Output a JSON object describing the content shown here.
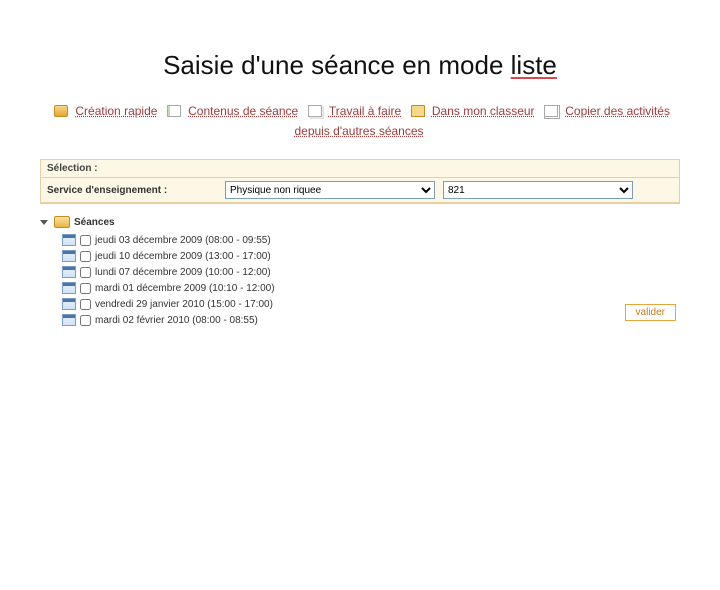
{
  "page": {
    "title_before": "Saisie d'une séance en mode ",
    "title_underlined": "liste"
  },
  "toolbar": {
    "creation_rapide": "Création rapide",
    "contenus_seance": "Contenus de séance",
    "travail_a_faire": "Travail à faire",
    "dans_mon_classeur": "Dans mon classeur",
    "copier_activites": "Copier des activités depuis d'autres séances"
  },
  "filter": {
    "selection_label": "Sélection :",
    "service_label": "Service d'enseignement :",
    "service_value": "Physique non riquee",
    "group_value": "821"
  },
  "seances": {
    "header": "Séances",
    "items": [
      {
        "label": "jeudi 03 décembre 2009 (08:00 - 09:55)"
      },
      {
        "label": "jeudi 10 décembre 2009 (13:00 - 17:00)"
      },
      {
        "label": "lundi 07 décembre 2009 (10:00 - 12:00)"
      },
      {
        "label": "mardi 01 décembre 2009 (10:10 - 12:00)"
      },
      {
        "label": "vendredi 29 janvier 2010 (15:00 - 17:00)"
      },
      {
        "label": "mardi 02 février 2010 (08:00 - 08:55)"
      }
    ],
    "validate": "valider"
  }
}
